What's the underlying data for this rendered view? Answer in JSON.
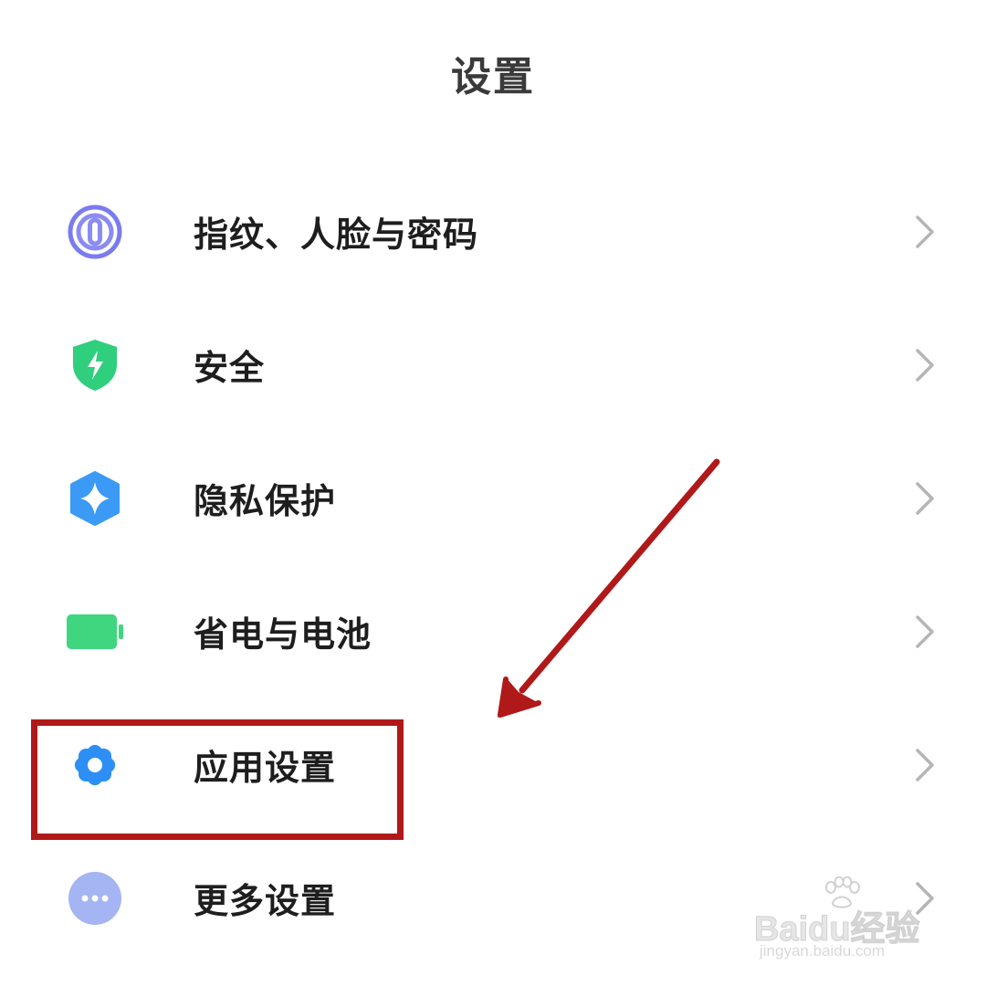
{
  "header": {
    "title": "设置"
  },
  "settings": {
    "items": [
      {
        "label": "指纹、人脸与密码",
        "icon": "fingerprint-icon",
        "icon_color": "#7b7bf0"
      },
      {
        "label": "安全",
        "icon": "shield-bolt-icon",
        "icon_color": "#2fcf7d"
      },
      {
        "label": "隐私保护",
        "icon": "privacy-hexagon-icon",
        "icon_color": "#3a9af5"
      },
      {
        "label": "省电与电池",
        "icon": "battery-icon",
        "icon_color": "#3fd67f"
      },
      {
        "label": "应用设置",
        "icon": "gear-icon",
        "icon_color": "#2d8ff5"
      },
      {
        "label": "更多设置",
        "icon": "more-dots-icon",
        "icon_color": "#a5b4f2"
      }
    ]
  },
  "annotation": {
    "highlight_color": "#b0191a",
    "highlighted_item": "应用设置"
  },
  "watermark": {
    "brand": "Baidu经验",
    "url": "jingyan.baidu.com"
  }
}
